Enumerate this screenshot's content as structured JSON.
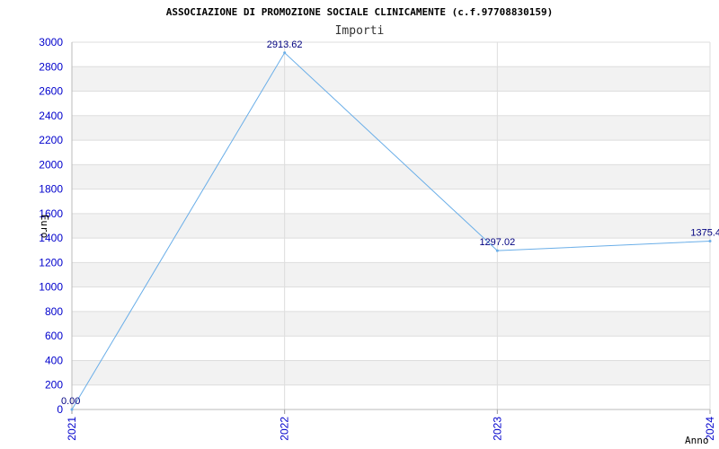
{
  "chart_data": {
    "type": "line",
    "title": "ASSOCIAZIONE DI PROMOZIONE SOCIALE CLINICAMENTE (c.f.97708830159)",
    "subtitle": "Importi",
    "xlabel": "Anno",
    "ylabel": "Euro",
    "categories": [
      "2021",
      "2022",
      "2023",
      "2024"
    ],
    "values": [
      0.0,
      2913.62,
      1297.02,
      1375.4
    ],
    "data_labels": [
      "0.00",
      "2913.62",
      "1297.02",
      "1375.4"
    ],
    "ylim": [
      0,
      3000
    ],
    "yticks": [
      0,
      200,
      400,
      600,
      800,
      1000,
      1200,
      1400,
      1600,
      1800,
      2000,
      2200,
      2400,
      2600,
      2800,
      3000
    ],
    "grid": true,
    "colors": {
      "line": "#6aaee8",
      "band": "#f2f2f2",
      "tick_text": "#0000cc",
      "data_label": "#000080"
    }
  }
}
